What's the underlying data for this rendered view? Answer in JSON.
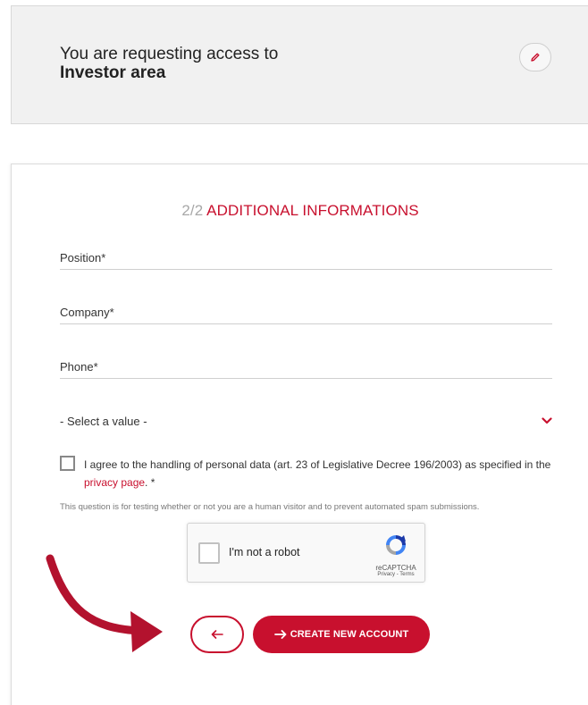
{
  "request": {
    "prefix": "You are requesting access to",
    "area": "Investor area",
    "edit_icon": "pencil-icon"
  },
  "form": {
    "step": "2/2",
    "title": "ADDITIONAL INFORMATIONS",
    "fields": {
      "position": "Position*",
      "company": "Company*",
      "phone": "Phone*"
    },
    "select": {
      "value": "- Select a value -",
      "icon": "chevron-down-icon"
    },
    "consent": {
      "text_before": "I agree to the handling of personal data (art. 23 of Legislative Decree 196/2003) as specified in the",
      "link": "privacy page",
      "text_after": ".  *"
    },
    "spam_note": "This question is for testing whether or not you are a human visitor and to prevent automated spam submissions.",
    "captcha": {
      "label": "I'm not a robot",
      "brand": "reCAPTCHA",
      "terms": "Privacy - Terms"
    },
    "buttons": {
      "back_icon": "arrow-left-icon",
      "create": "CREATE NEW ACCOUNT"
    }
  },
  "colors": {
    "accent": "#c8102e",
    "card_bg": "#f1f1f1"
  }
}
